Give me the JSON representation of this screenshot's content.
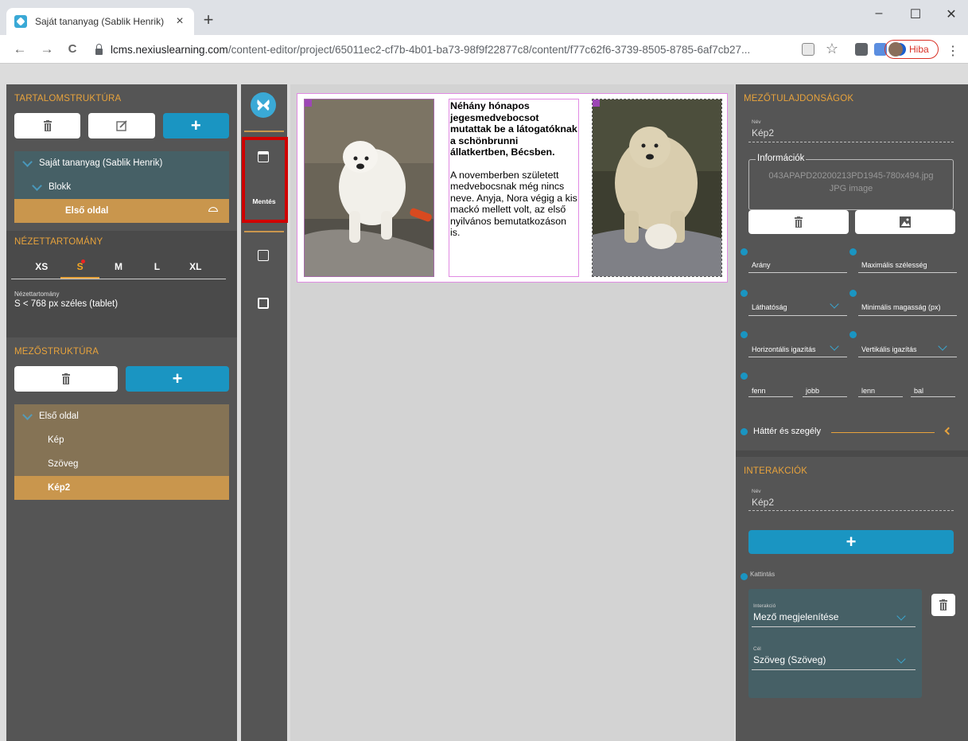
{
  "browser": {
    "tab_title": "Saját tananyag (Sablik Henrik)",
    "tab_close": "×",
    "new_tab": "+",
    "url_host": "lcms.nexiuslearning.com",
    "url_path": "/content-editor/project/65011ec2-cf7b-4b01-ba73-98f9f22877c8/content/f77c62f6-3739-8505-8785-6af7cb27...",
    "profile_label": "Hiba",
    "minimize": "–",
    "maximize": "☐",
    "close": "✕",
    "back": "←",
    "forward": "→",
    "reload": "C",
    "kebab": "⋮",
    "star": "☆"
  },
  "left": {
    "content_structure_title": "TARTALOMSTRUKTÚRA",
    "delete_icon": "trash-icon",
    "edit_icon": "edit-icon",
    "add_label": "+",
    "tree": [
      {
        "label": "Saját tananyag (Sablik Henrik)"
      },
      {
        "label": "Blokk"
      },
      {
        "label": "Első oldal"
      }
    ],
    "breakpoint_title": "NÉZETTARTOMÁNY",
    "breakpoints": [
      "XS",
      "S",
      "M",
      "L",
      "XL"
    ],
    "active_breakpoint": "S",
    "breakpoint_info_label": "Nézettartomány",
    "breakpoint_info_value": "S < 768 px széles (tablet)",
    "field_structure_title": "MEZŐSTRUKTÚRA",
    "fields_parent": "Első oldal",
    "fields": [
      "Kép",
      "Szöveg",
      "Kép2"
    ],
    "selected_field": "Kép2"
  },
  "toolbar": {
    "save_label": "Mentés"
  },
  "canvas": {
    "text_bold": "Néhány hónapos jegesmedvebocsot mutattak be a látogatóknak a schönbrunni állatkertben, Bécsben.",
    "text_body": "A novemberben született medvebocsnak még nincs neve. Anyja, Nora végig a kis mackó mellett volt, az első nyilvános bemutatkozáson is."
  },
  "right": {
    "properties_title": "MEZŐTULAJDONSÁGOK",
    "name_label": "Név",
    "name_value": "Kép2",
    "info_legend": "Információk",
    "file_name": "043APAPD20200213PD1945-780x494.jpg",
    "file_type": "JPG image",
    "ratio_label": "Arány",
    "max_width_label": "Maximális szélesség",
    "visibility_label": "Láthatóság",
    "min_height_label": "Minimális magasság (px)",
    "h_align_label": "Horizontális igazítás",
    "v_align_label": "Vertikális igazítás",
    "top_label": "fenn",
    "right_label": "jobb",
    "bottom_label": "lenn",
    "left_label": "bal",
    "bg_border_label": "Háttér és szegély",
    "interactions_title": "INTERAKCIÓK",
    "interactions_name_label": "Név",
    "interactions_name_value": "Kép2",
    "add_interaction": "+",
    "click_label": "Kattintás",
    "interaction_label": "Interakció",
    "interaction_value": "Mező megjelenítése",
    "target_label": "Cél",
    "target_value": "Szöveg (Szöveg)"
  },
  "colors": {
    "accent_orange": "#e8a33c",
    "accent_blue": "#1a95c2",
    "panel_bg": "#555555",
    "highlight_red": "#d00000"
  }
}
